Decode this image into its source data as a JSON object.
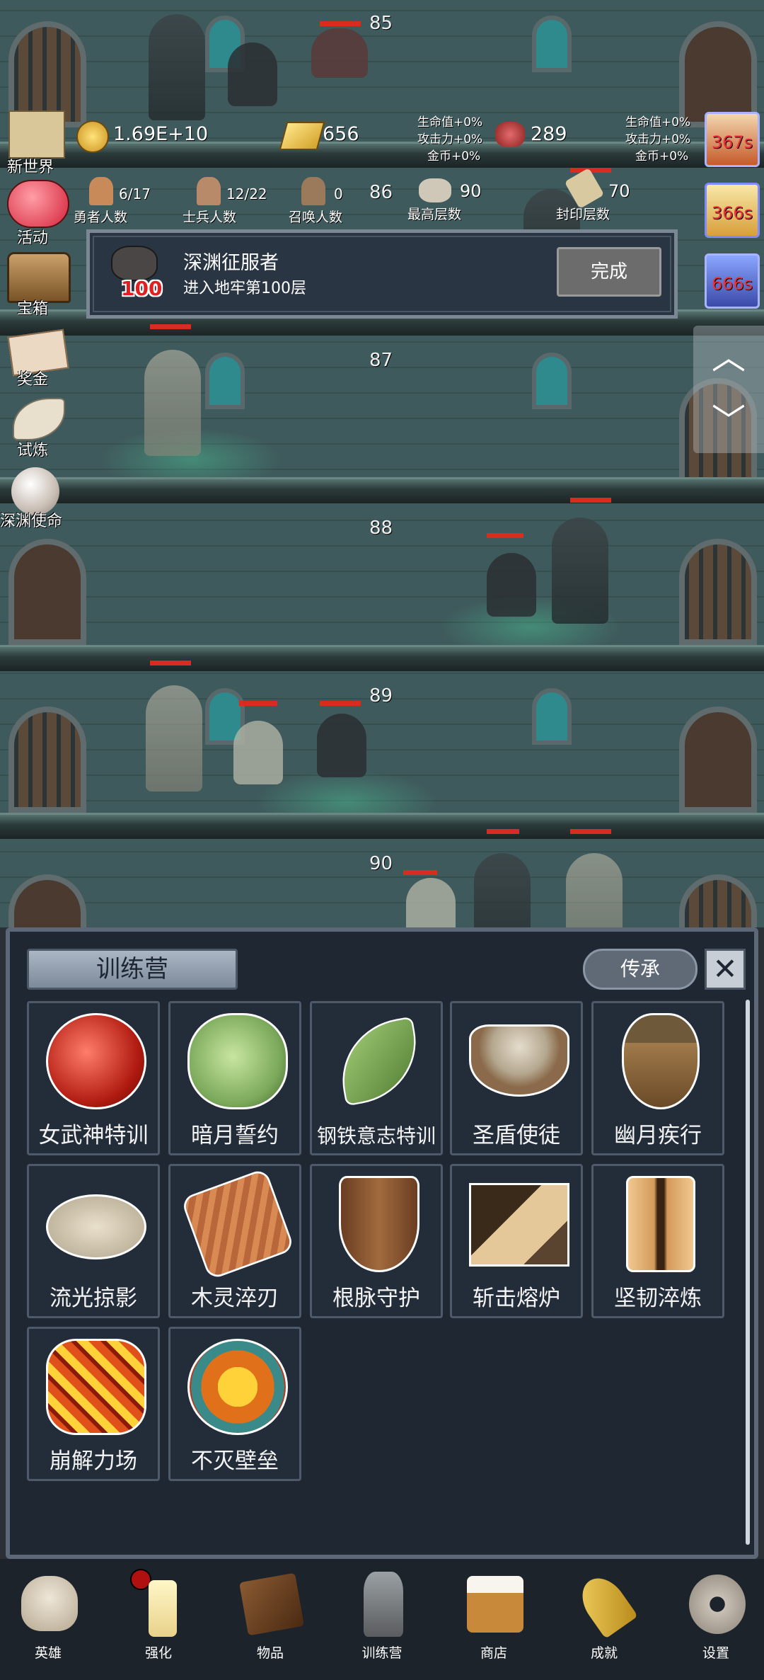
{
  "floors": [
    "85",
    "86",
    "87",
    "88",
    "89",
    "90"
  ],
  "resources": {
    "gold": "1.69E+10",
    "bars": "656",
    "meat": "289",
    "buffs1": [
      "生命值+0%",
      "攻击力+0%",
      "金币+0%"
    ],
    "buffs2": [
      "生命值+0%",
      "攻击力+0%",
      "金币+0%"
    ]
  },
  "stats": [
    {
      "value": "6/17",
      "label": "勇者人数"
    },
    {
      "value": "12/22",
      "label": "士兵人数"
    },
    {
      "value": "0",
      "label": "召唤人数"
    },
    {
      "value": "90",
      "label": "最高层数"
    },
    {
      "value": "70",
      "label": "封印层数"
    }
  ],
  "side_menu": [
    "新世界",
    "活动",
    "宝箱",
    "奖金",
    "试炼",
    "深渊使命"
  ],
  "timers": [
    "367s",
    "366s",
    "666s"
  ],
  "achievement": {
    "badge": "100",
    "title": "深渊征服者",
    "desc": "进入地牢第100层",
    "button": "完成"
  },
  "panel": {
    "title": "训练营",
    "legacy_button": "传承",
    "items": [
      "女武神特训",
      "暗月誓约",
      "钢铁意志特训",
      "圣盾使徒",
      "幽月疾行",
      "流光掠影",
      "木灵淬刃",
      "根脉守护",
      "斩击熔炉",
      "坚韧淬炼",
      "崩解力场",
      "不灭壁垒"
    ]
  },
  "nav": [
    "英雄",
    "强化",
    "物品",
    "训练营",
    "商店",
    "成就",
    "设置"
  ],
  "colors": {
    "hp_bar": "#d82c20",
    "panel_bg": "#1f2733",
    "timer_text": "#e9323a"
  }
}
